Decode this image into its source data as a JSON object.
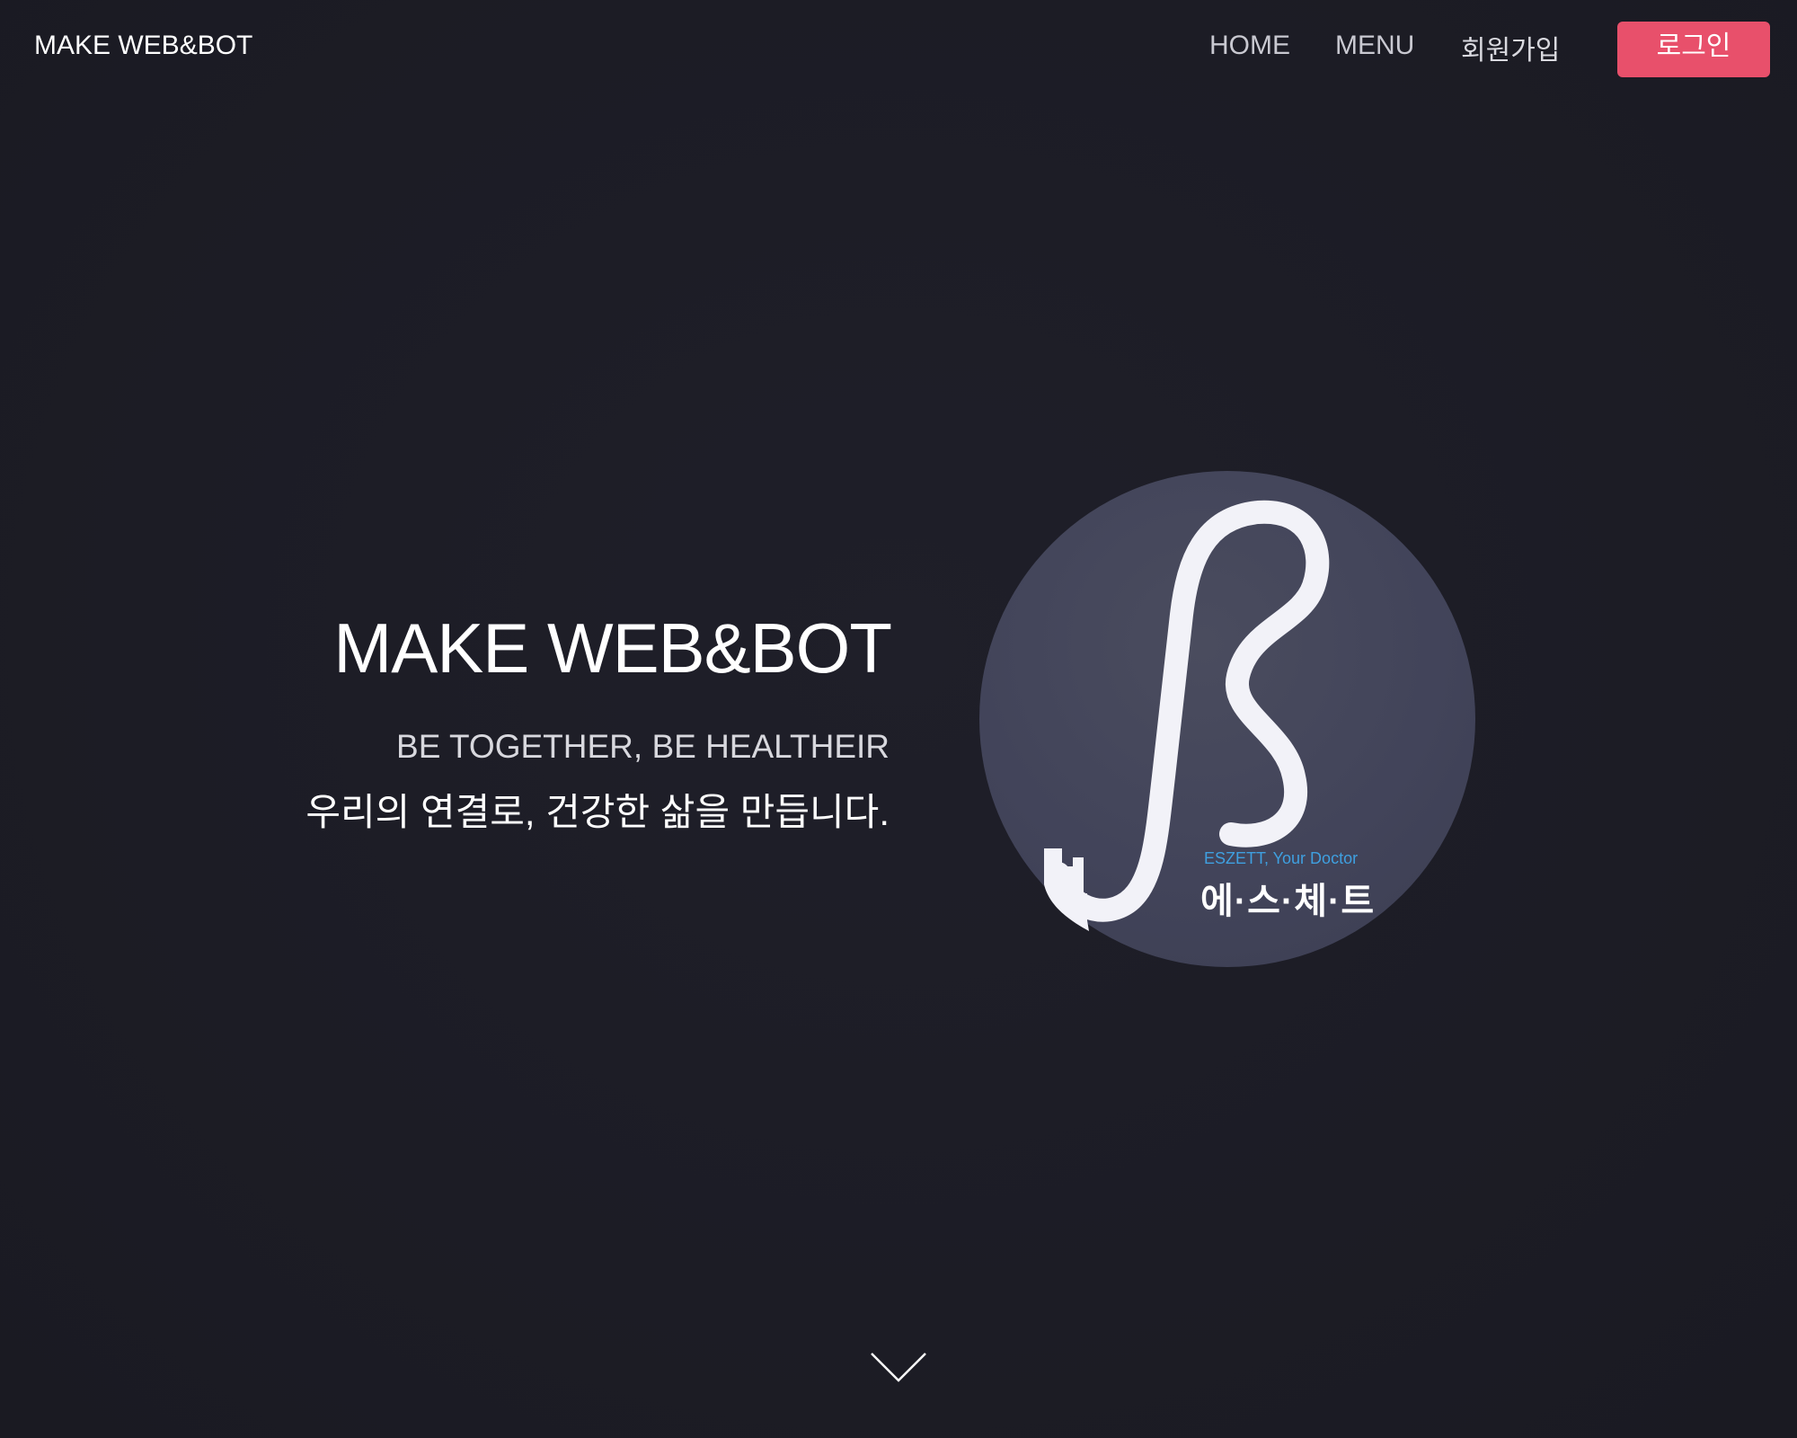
{
  "navbar": {
    "brand": "MAKE WEB&BOT",
    "links": {
      "home": "HOME",
      "menu": "MENU",
      "signup": "회원가입"
    },
    "login_label": "로그인"
  },
  "hero": {
    "title": "MAKE WEB&BOT",
    "subtitle_en": "BE TOGETHER, BE HEALTHEIR",
    "subtitle_ko": "우리의 연결로, 건강한 삶을 만듭니다."
  },
  "logo": {
    "tagline_en": "ESZETT, Your Doctor",
    "name_ko": "에·스·체·트",
    "icon": "eszett-stethoscope-icon"
  },
  "scroll": {
    "icon": "chevron-down-icon"
  },
  "colors": {
    "background": "#1c1c25",
    "accent": "#e8506b",
    "logo_circle": "#42445a",
    "logo_tagline": "#3fa0e0"
  }
}
